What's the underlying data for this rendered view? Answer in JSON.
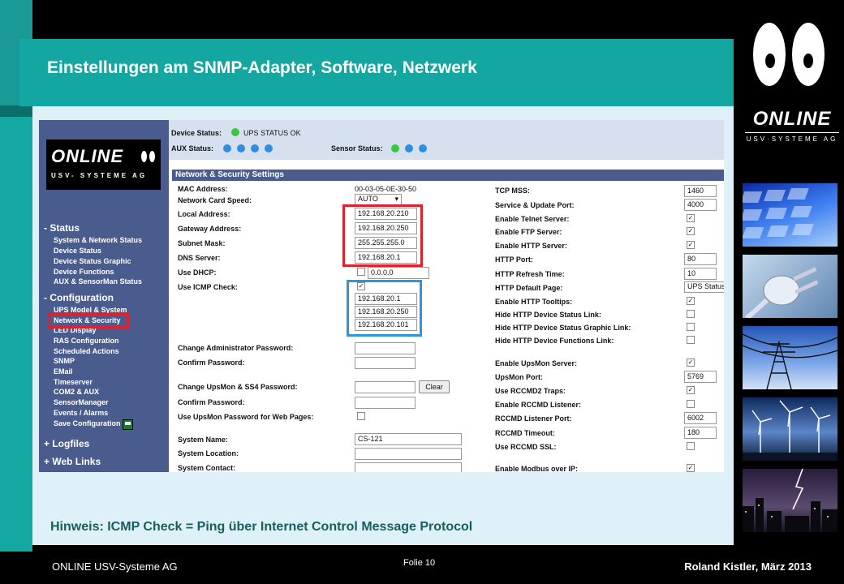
{
  "slide": {
    "title": "Einstellungen am SNMP-Adapter, Software, Netzwerk",
    "note": "Hinweis: ICMP Check = Ping über Internet Control Message Protocol",
    "footer_left": "ONLINE USV-Systeme AG",
    "footer_center": "Folie 10",
    "footer_right": "Roland Kistler, März 2013",
    "brand": "ONLINE",
    "brand_sub": "USV·SYSTEME AG"
  },
  "screenshot": {
    "logo": "ONLINE",
    "logo_sub": "USV- SYSTEME AG",
    "nav": {
      "status": "- Status",
      "status_items": [
        "System & Network Status",
        "Device Status",
        "Device Status Graphic",
        "Device Functions",
        "AUX & SensorMan Status"
      ],
      "config": "- Configuration",
      "config_items": [
        "UPS Model & System",
        "Network & Security",
        "LED Display",
        "RAS Configuration",
        "Scheduled Actions",
        "SNMP",
        "EMail",
        "Timeserver",
        "COM2 & AUX",
        "SensorManager",
        "Events / Alarms",
        "Save Configuration"
      ],
      "logfiles": "+ Logfiles",
      "weblinks": "+ Web Links"
    },
    "status": {
      "device_label": "Device Status:",
      "device_value": "UPS STATUS OK",
      "aux_label": "AUX Status:",
      "sensor_label": "Sensor Status:"
    },
    "section": "Network & Security Settings",
    "left": {
      "mac_label": "MAC Address:",
      "mac": "00-03-05-0E-30-50",
      "speed_label": "Network Card Speed:",
      "speed": "AUTO",
      "local_label": "Local Address:",
      "local": "192.168.20.210",
      "gateway_label": "Gateway Address:",
      "gateway": "192.168.20.250",
      "subnet_label": "Subnet Mask:",
      "subnet": "255.255.255.0",
      "dns_label": "DNS Server:",
      "dns": "192.168.20.1",
      "dhcp_label": "Use DHCP:",
      "dhcp_ip": "0.0.0.0",
      "icmp_label": "Use ICMP Check:",
      "icmp1": "192.168.20.1",
      "icmp2": "192.168.20.250",
      "icmp3": "192.168.20.101",
      "admin_pw": "Change Administrator Password:",
      "confirm1": "Confirm Password:",
      "ups_pw": "Change UpsMon & SS4 Password:",
      "clear": "Clear",
      "confirm2": "Confirm Password:",
      "use_upsmon": "Use UpsMon Password for Web Pages:",
      "sysname_label": "System Name:",
      "sysname": "CS-121",
      "sysloc": "System Location:",
      "syscontact": "System Contact:"
    },
    "right": {
      "mss_label": "TCP MSS:",
      "mss": "1460",
      "svc_label": "Service & Update Port:",
      "svc": "4000",
      "telnet": "Enable Telnet Server:",
      "ftp": "Enable FTP Server:",
      "http": "Enable HTTP Server:",
      "httpport_label": "HTTP Port:",
      "httpport": "80",
      "refresh_label": "HTTP Refresh Time:",
      "refresh": "10",
      "default_label": "HTTP Default Page:",
      "default": "UPS Status",
      "tooltips": "Enable HTTP Tooltips:",
      "hide1": "Hide HTTP Device Status Link:",
      "hide2": "Hide HTTP Device Status Graphic Link:",
      "hide3": "Hide HTTP Device Functions Link:",
      "upsmon": "Enable UpsMon Server:",
      "upsmonport_label": "UpsMon Port:",
      "upsmonport": "5769",
      "rccmd2": "Use RCCMD2 Traps:",
      "rccmdlisten": "Enable RCCMD Listener:",
      "rccmdport_label": "RCCMD Listener Port:",
      "rccmdport": "6002",
      "rccmdto_label": "RCCMD Timeout:",
      "rccmdto": "180",
      "rccmdssl": "Use RCCMD SSL:",
      "modbus": "Enable Modbus over IP:"
    },
    "colors": {
      "nav": "#4a5c8e",
      "red_box": "#e0202a",
      "blue_box": "#2c98d8",
      "green_led": "#3cc83c",
      "blue_led": "#2e8ee0"
    }
  }
}
